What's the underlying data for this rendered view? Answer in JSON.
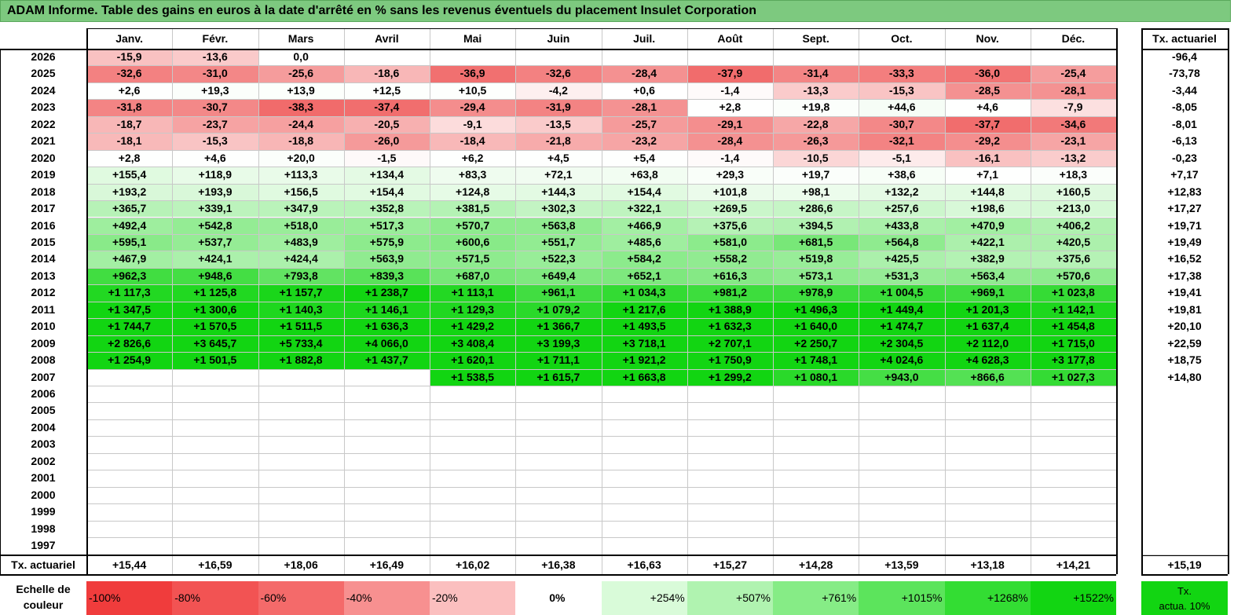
{
  "title": "ADAM Informe. Table des gains en euros à la date d'arrêté en % sans les revenus éventuels du placement Insulet Corporation",
  "months": [
    "Janv.",
    "Févr.",
    "Mars",
    "Avril",
    "Mai",
    "Juin",
    "Juil.",
    "Août",
    "Sept.",
    "Oct.",
    "Nov.",
    "Déc."
  ],
  "rate_header": "Tx. actuariel",
  "rows": [
    {
      "year": "2026",
      "values": [
        "-15,9",
        "-13,6",
        "0,0",
        "",
        "",
        "",
        "",
        "",
        "",
        "",
        "",
        ""
      ],
      "rate": "-96,4"
    },
    {
      "year": "2025",
      "values": [
        "-32,6",
        "-31,0",
        "-25,6",
        "-18,6",
        "-36,9",
        "-32,6",
        "-28,4",
        "-37,9",
        "-31,4",
        "-33,3",
        "-36,0",
        "-25,4"
      ],
      "rate": "-73,78"
    },
    {
      "year": "2024",
      "values": [
        "+2,6",
        "+19,3",
        "+13,9",
        "+12,5",
        "+10,5",
        "-4,2",
        "+0,6",
        "-1,4",
        "-13,3",
        "-15,3",
        "-28,5",
        "-28,1"
      ],
      "rate": "-3,44"
    },
    {
      "year": "2023",
      "values": [
        "-31,8",
        "-30,7",
        "-38,3",
        "-37,4",
        "-29,4",
        "-31,9",
        "-28,1",
        "+2,8",
        "+19,8",
        "+44,6",
        "+4,6",
        "-7,9"
      ],
      "rate": "-8,05"
    },
    {
      "year": "2022",
      "values": [
        "-18,7",
        "-23,7",
        "-24,4",
        "-20,5",
        "-9,1",
        "-13,5",
        "-25,7",
        "-29,1",
        "-22,8",
        "-30,7",
        "-37,7",
        "-34,6"
      ],
      "rate": "-8,01"
    },
    {
      "year": "2021",
      "values": [
        "-18,1",
        "-15,3",
        "-18,8",
        "-26,0",
        "-18,4",
        "-21,8",
        "-23,2",
        "-28,4",
        "-26,3",
        "-32,1",
        "-29,2",
        "-23,1"
      ],
      "rate": "-6,13"
    },
    {
      "year": "2020",
      "values": [
        "+2,8",
        "+4,6",
        "+20,0",
        "-1,5",
        "+6,2",
        "+4,5",
        "+5,4",
        "-1,4",
        "-10,5",
        "-5,1",
        "-16,1",
        "-13,2"
      ],
      "rate": "-0,23"
    },
    {
      "year": "2019",
      "values": [
        "+155,4",
        "+118,9",
        "+113,3",
        "+134,4",
        "+83,3",
        "+72,1",
        "+63,8",
        "+29,3",
        "+19,7",
        "+38,6",
        "+7,1",
        "+18,3"
      ],
      "rate": "+7,17"
    },
    {
      "year": "2018",
      "values": [
        "+193,2",
        "+193,9",
        "+156,5",
        "+154,4",
        "+124,8",
        "+144,3",
        "+154,4",
        "+101,8",
        "+98,1",
        "+132,2",
        "+144,8",
        "+160,5"
      ],
      "rate": "+12,83"
    },
    {
      "year": "2017",
      "values": [
        "+365,7",
        "+339,1",
        "+347,9",
        "+352,8",
        "+381,5",
        "+302,3",
        "+322,1",
        "+269,5",
        "+286,6",
        "+257,6",
        "+198,6",
        "+213,0"
      ],
      "rate": "+17,27"
    },
    {
      "year": "2016",
      "values": [
        "+492,4",
        "+542,8",
        "+518,0",
        "+517,3",
        "+570,7",
        "+563,8",
        "+466,9",
        "+375,6",
        "+394,5",
        "+433,8",
        "+470,9",
        "+406,2"
      ],
      "rate": "+19,71"
    },
    {
      "year": "2015",
      "values": [
        "+595,1",
        "+537,7",
        "+483,9",
        "+575,9",
        "+600,6",
        "+551,7",
        "+485,6",
        "+581,0",
        "+681,5",
        "+564,8",
        "+422,1",
        "+420,5"
      ],
      "rate": "+19,49"
    },
    {
      "year": "2014",
      "values": [
        "+467,9",
        "+424,1",
        "+424,4",
        "+563,9",
        "+571,5",
        "+522,3",
        "+584,2",
        "+558,2",
        "+519,8",
        "+425,5",
        "+382,9",
        "+375,6"
      ],
      "rate": "+16,52"
    },
    {
      "year": "2013",
      "values": [
        "+962,3",
        "+948,6",
        "+793,8",
        "+839,3",
        "+687,0",
        "+649,4",
        "+652,1",
        "+616,3",
        "+573,1",
        "+531,3",
        "+563,4",
        "+570,6"
      ],
      "rate": "+17,38"
    },
    {
      "year": "2012",
      "values": [
        "+1 117,3",
        "+1 125,8",
        "+1 157,7",
        "+1 238,7",
        "+1 113,1",
        "+961,1",
        "+1 034,3",
        "+981,2",
        "+978,9",
        "+1 004,5",
        "+969,1",
        "+1 023,8"
      ],
      "rate": "+19,41"
    },
    {
      "year": "2011",
      "values": [
        "+1 347,5",
        "+1 300,6",
        "+1 140,3",
        "+1 146,1",
        "+1 129,3",
        "+1 079,2",
        "+1 217,6",
        "+1 388,9",
        "+1 496,3",
        "+1 449,4",
        "+1 201,3",
        "+1 142,1"
      ],
      "rate": "+19,81"
    },
    {
      "year": "2010",
      "values": [
        "+1 744,7",
        "+1 570,5",
        "+1 511,5",
        "+1 636,3",
        "+1 429,2",
        "+1 366,7",
        "+1 493,5",
        "+1 632,3",
        "+1 640,0",
        "+1 474,7",
        "+1 637,4",
        "+1 454,8"
      ],
      "rate": "+20,10"
    },
    {
      "year": "2009",
      "values": [
        "+2 826,6",
        "+3 645,7",
        "+5 733,4",
        "+4 066,0",
        "+3 408,4",
        "+3 199,3",
        "+3 718,1",
        "+2 707,1",
        "+2 250,7",
        "+2 304,5",
        "+2 112,0",
        "+1 715,0"
      ],
      "rate": "+22,59"
    },
    {
      "year": "2008",
      "values": [
        "+1 254,9",
        "+1 501,5",
        "+1 882,8",
        "+1 437,7",
        "+1 620,1",
        "+1 711,1",
        "+1 921,2",
        "+1 750,9",
        "+1 748,1",
        "+4 024,6",
        "+4 628,3",
        "+3 177,8"
      ],
      "rate": "+18,75"
    },
    {
      "year": "2007",
      "values": [
        "",
        "",
        "",
        "",
        "+1 538,5",
        "+1 615,7",
        "+1 663,8",
        "+1 299,2",
        "+1 080,1",
        "+943,0",
        "+866,6",
        "+1 027,3"
      ],
      "rate": "+14,80"
    },
    {
      "year": "2006",
      "values": [
        "",
        "",
        "",
        "",
        "",
        "",
        "",
        "",
        "",
        "",
        "",
        ""
      ],
      "rate": ""
    },
    {
      "year": "2005",
      "values": [
        "",
        "",
        "",
        "",
        "",
        "",
        "",
        "",
        "",
        "",
        "",
        ""
      ],
      "rate": ""
    },
    {
      "year": "2004",
      "values": [
        "",
        "",
        "",
        "",
        "",
        "",
        "",
        "",
        "",
        "",
        "",
        ""
      ],
      "rate": ""
    },
    {
      "year": "2003",
      "values": [
        "",
        "",
        "",
        "",
        "",
        "",
        "",
        "",
        "",
        "",
        "",
        ""
      ],
      "rate": ""
    },
    {
      "year": "2002",
      "values": [
        "",
        "",
        "",
        "",
        "",
        "",
        "",
        "",
        "",
        "",
        "",
        ""
      ],
      "rate": ""
    },
    {
      "year": "2001",
      "values": [
        "",
        "",
        "",
        "",
        "",
        "",
        "",
        "",
        "",
        "",
        "",
        ""
      ],
      "rate": ""
    },
    {
      "year": "2000",
      "values": [
        "",
        "",
        "",
        "",
        "",
        "",
        "",
        "",
        "",
        "",
        "",
        ""
      ],
      "rate": ""
    },
    {
      "year": "1999",
      "values": [
        "",
        "",
        "",
        "",
        "",
        "",
        "",
        "",
        "",
        "",
        "",
        ""
      ],
      "rate": ""
    },
    {
      "year": "1998",
      "values": [
        "",
        "",
        "",
        "",
        "",
        "",
        "",
        "",
        "",
        "",
        "",
        ""
      ],
      "rate": ""
    },
    {
      "year": "1997",
      "values": [
        "",
        "",
        "",
        "",
        "",
        "",
        "",
        "",
        "",
        "",
        "",
        ""
      ],
      "rate": ""
    }
  ],
  "total_row": {
    "label": "Tx. actuariel",
    "values": [
      "+15,44",
      "+16,59",
      "+18,06",
      "+16,49",
      "+16,02",
      "+16,38",
      "+16,63",
      "+15,27",
      "+14,28",
      "+13,59",
      "+13,18",
      "+14,21"
    ],
    "rate": "+15,19"
  },
  "scale": {
    "label_line1": "Echelle de",
    "label_line2": "couleur",
    "items": [
      {
        "label": "-100%",
        "color": "#f03c3c"
      },
      {
        "label": "-80%",
        "color": "#f25353"
      },
      {
        "label": "-60%",
        "color": "#f46a6a"
      },
      {
        "label": "-40%",
        "color": "#f79090"
      },
      {
        "label": "-20%",
        "color": "#fbbfbf"
      },
      {
        "label": "0%",
        "color": "#ffffff"
      },
      {
        "label": "+254%",
        "color": "#d9fbd9"
      },
      {
        "label": "+507%",
        "color": "#b0f3b0"
      },
      {
        "label": "+761%",
        "color": "#86ec86"
      },
      {
        "label": "+1015%",
        "color": "#5ce45c"
      },
      {
        "label": "+1268%",
        "color": "#33dd33"
      },
      {
        "label": "+1522%",
        "color": "#12d512"
      }
    ],
    "rate_line1": "Tx.",
    "rate_line2": "actua. 10%",
    "rate_color": "#12d512"
  },
  "colors": {
    "title_bg": "#7dc97f",
    "grid": "#c8c8c8",
    "border": "#000000"
  }
}
